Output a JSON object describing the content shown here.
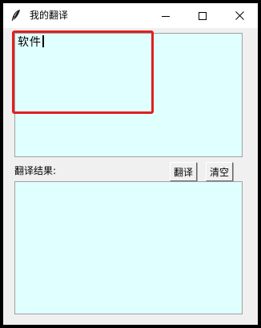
{
  "window": {
    "title": "我的翻译",
    "app_icon": "feather-icon",
    "controls": [
      "minimize-icon",
      "maximize-icon",
      "close-icon"
    ]
  },
  "input": {
    "value": "软件",
    "background": "#e0ffff",
    "highlight_color": "#e02020"
  },
  "result": {
    "label": "翻译结果:",
    "value": ""
  },
  "buttons": {
    "translate": "翻译",
    "clear": "清空"
  }
}
